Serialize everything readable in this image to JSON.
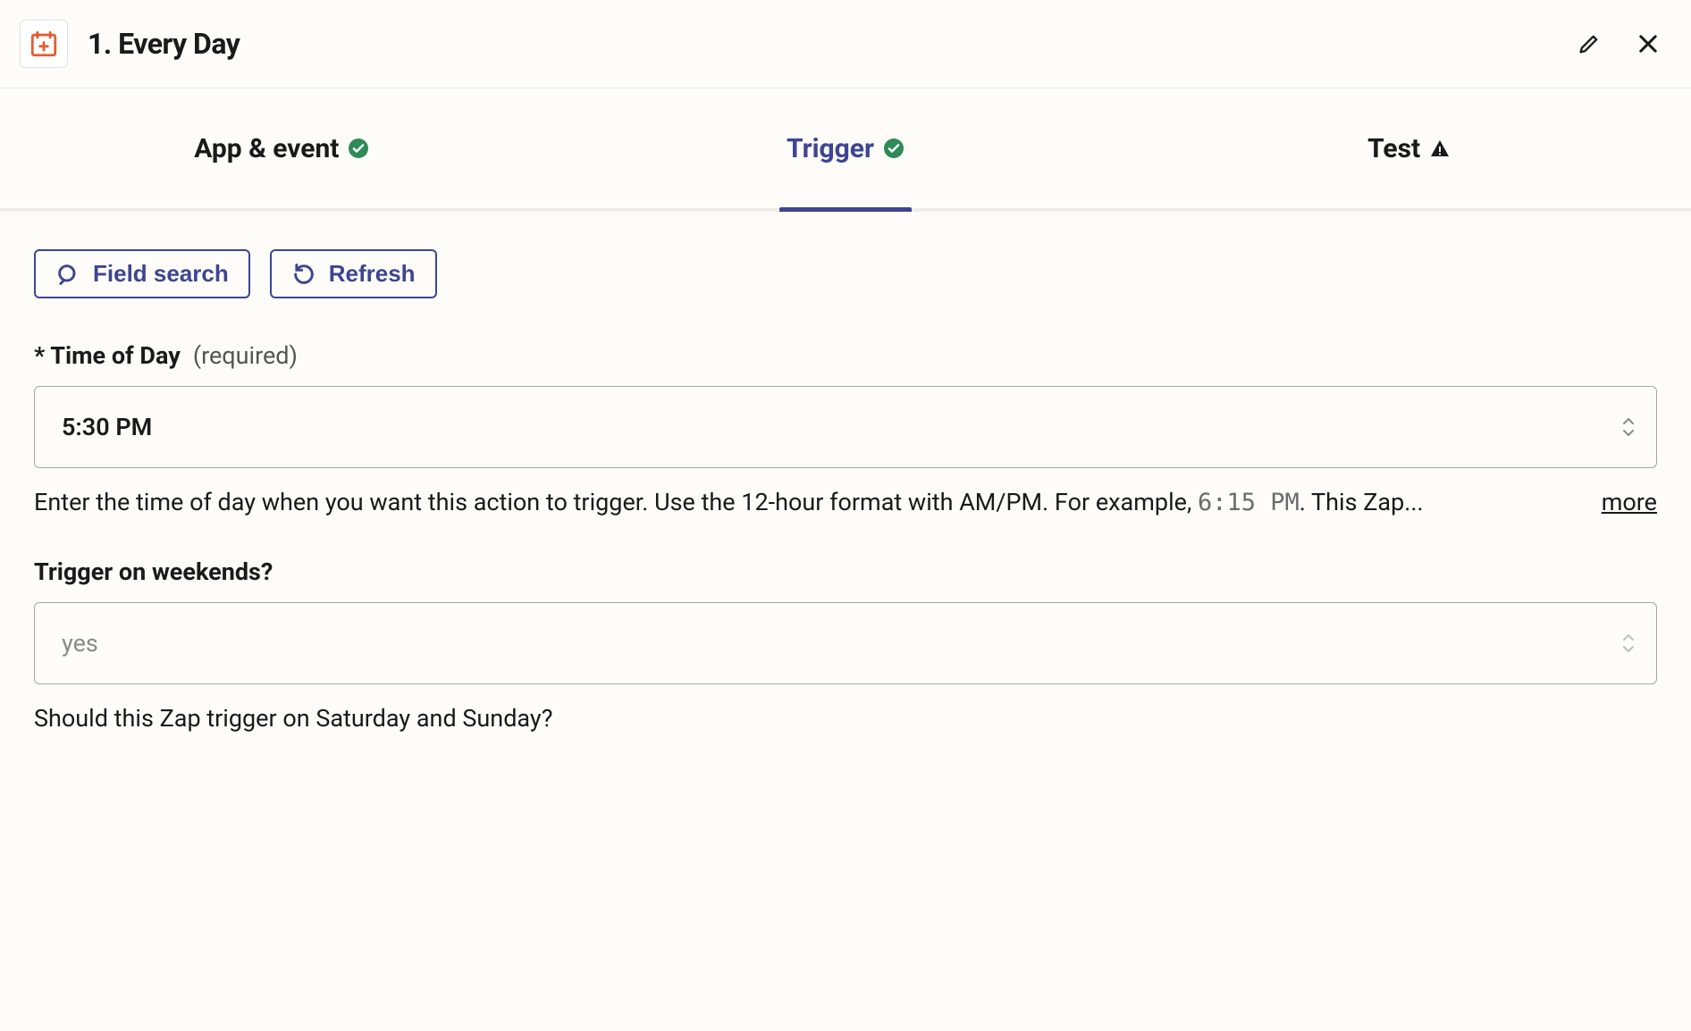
{
  "header": {
    "title": "1. Every Day"
  },
  "tabs": {
    "app_event": "App & event",
    "trigger": "Trigger",
    "test": "Test"
  },
  "buttons": {
    "field_search": "Field search",
    "refresh": "Refresh"
  },
  "fields": {
    "time_of_day": {
      "label": "Time of Day",
      "required_text": "(required)",
      "value": "5:30 PM",
      "help_pre": "Enter the time of day when you want this action to trigger. Use the 12-hour format with AM/PM. For example, ",
      "help_code": "6:15 PM",
      "help_post": ". This Zap...",
      "more": "more"
    },
    "weekends": {
      "label": "Trigger on weekends?",
      "placeholder": "yes",
      "help": "Should this Zap trigger on Saturday and Sunday?"
    }
  }
}
